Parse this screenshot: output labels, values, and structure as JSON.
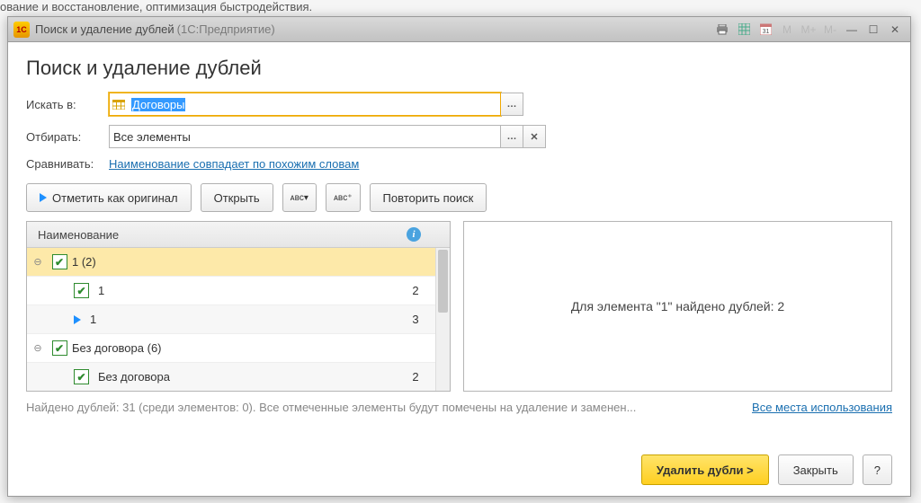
{
  "backdrop_text": "ование и восстановление, оптимизация быстродействия.",
  "titlebar": {
    "logo": "1C",
    "title": "Поиск и удаление дублей",
    "subtitle": "(1С:Предприятие)",
    "m1": "M",
    "m2": "M+",
    "m3": "M-"
  },
  "page": {
    "heading": "Поиск и удаление дублей",
    "search_label": "Искать в:",
    "search_value": "Договоры",
    "filter_label": "Отбирать:",
    "filter_value": "Все элементы",
    "compare_label": "Сравнивать:",
    "compare_link": "Наименование совпадает по похожим словам"
  },
  "toolbar": {
    "mark_original": "Отметить как оригинал",
    "open": "Открыть",
    "repeat": "Повторить поиск"
  },
  "tree": {
    "header_name": "Наименование",
    "rows": [
      {
        "type": "group",
        "expand": "⊖",
        "label": "1 (2)",
        "val": ""
      },
      {
        "type": "child",
        "icon": "chk",
        "label": "1",
        "val": "2"
      },
      {
        "type": "child",
        "icon": "arr",
        "label": "1",
        "val": "3"
      },
      {
        "type": "group",
        "expand": "⊖",
        "label": "Без договора (6)",
        "val": ""
      },
      {
        "type": "child",
        "icon": "chk",
        "label": "Без договора",
        "val": "2"
      }
    ]
  },
  "preview": "Для элемента \"1\" найдено дублей: 2",
  "status_text": "Найдено дублей: 31 (среди элементов: 0). Все отмеченные элементы будут помечены на удаление и заменен...",
  "status_link": "Все места использования",
  "footer": {
    "delete": "Удалить дубли >",
    "close": "Закрыть",
    "help": "?"
  }
}
